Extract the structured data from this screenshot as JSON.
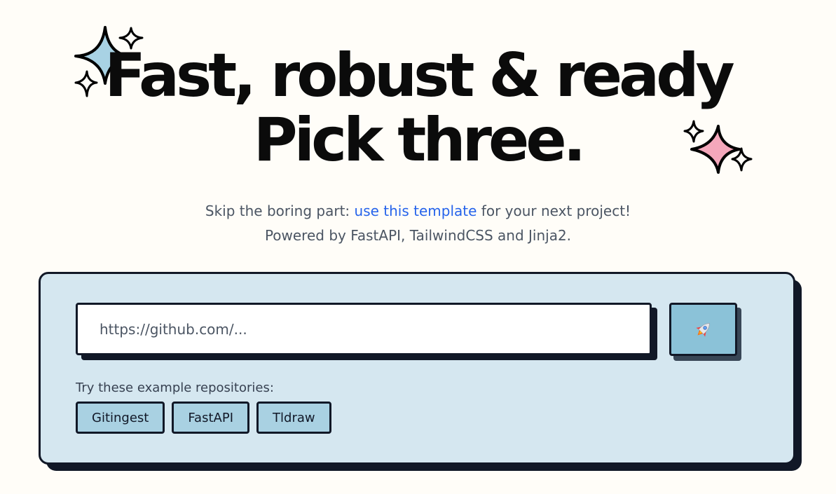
{
  "hero": {
    "line1": "Fast, robust & ready",
    "line2": "Pick three."
  },
  "subtitle": {
    "before_link": "Skip the boring part: ",
    "link_text": "use this template",
    "after_link": " for your next project!",
    "line2": "Powered by FastAPI, TailwindCSS and Jinja2."
  },
  "form": {
    "url_placeholder": "https://github.com/...",
    "url_value": "",
    "submit_icon": "rocket-icon"
  },
  "examples": {
    "label": "Try these example repositories:",
    "items": [
      {
        "label": "Gitingest"
      },
      {
        "label": "FastAPI"
      },
      {
        "label": "Tldraw"
      }
    ]
  },
  "colors": {
    "background": "#fffdf8",
    "card": "#d5e7f0",
    "border": "#111827",
    "link": "#2563eb",
    "submit": "#8bc2d8",
    "example_button": "#a9d1e2",
    "sparkle_blue": "#a8d2e4",
    "sparkle_pink": "#f4a7bb"
  },
  "icons": {
    "sparkle_left": "sparkles-blue-icon",
    "sparkle_right": "sparkles-pink-icon"
  }
}
